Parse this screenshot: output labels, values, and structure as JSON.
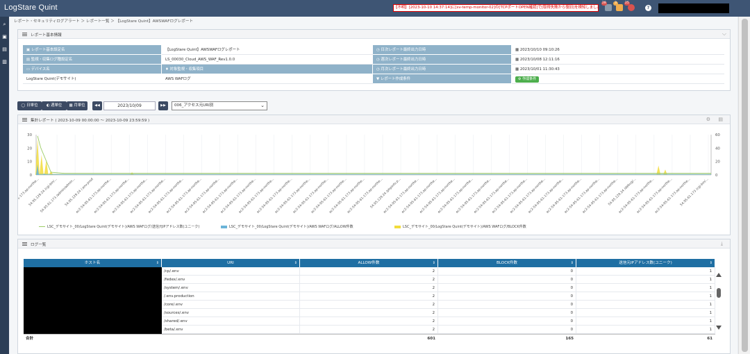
{
  "header": {
    "logo": "LogStare Quint",
    "alert": "【不明】[2023-10-10 14:37:14]に[sv-temp-monitor-02]の[TCPポートOPEN確認]で[取得失敗から復旧]を検知しました",
    "badges": [
      "28",
      "3",
      "25"
    ],
    "help": "?"
  },
  "breadcrumb": "レポート・セキュリティログアラート ＞ レポート一覧 ＞ 【LogStare Quint】AWSWAFログレポート",
  "report_info": {
    "panel_title": "レポート基本情報",
    "rows": [
      {
        "h1": "レポート基本設定名",
        "v1": "【LogStare Quint】AWSWAFログレポート",
        "h2": "日次レポート最終出力日時",
        "v2": "2023/10/10  09:10:26"
      },
      {
        "h1": "監視・収集ログ種設定名",
        "v1": "LS_00030_Cloud_AWS_WAF_Rev1.0.0",
        "h2": "週次レポート最終出力日時",
        "v2": "2023/10/08  12:11:16"
      },
      {
        "h1": "デバイス名",
        "v1": "対象監視・収集項目",
        "h2": "月次レポート最終出力日時",
        "v2": "2023/10/01  11:30:43"
      },
      {
        "h1": "LogStare Quint(デモサイト)",
        "v1": "AWS WAFログ",
        "h2": "レポート作成条件",
        "v2": "作成条件"
      }
    ]
  },
  "controls": {
    "daily": "日単位",
    "weekly": "週単位",
    "monthly": "月単位",
    "prev": "◀◀",
    "date": "2023/10/09",
    "next": "▶▶",
    "report_select": "006_アクセス元URI別"
  },
  "chart_panel": {
    "title": "集計レポート ( 2023-10-09 00:00:00 ～ 2023-10-09 23:59:59 )"
  },
  "chart_data": {
    "type": "area",
    "left_axis": {
      "ticks": [
        "30",
        "20",
        "10",
        "0"
      ],
      "ylim": [
        0,
        30
      ]
    },
    "right_axis": {
      "ticks": [
        "60",
        "40",
        "20",
        "0"
      ],
      "ylim": [
        0,
        60
      ]
    },
    "x_tick_labels": [
      "ec2-54-95-61-173.ap-northe...",
      "54.95.129.24 /cgi-bin/...",
      "54.95.61.173 /admin/admin...",
      "54.95.129.24 /.env.prod",
      "ec2-54-95-61-173.ap-northe...",
      "ec2-54-95-61-173.ap-northe...",
      "ec2-54-95-61-173.ap-northe...",
      "ec2-54-95-61-173.ap-northe...",
      "ec2-54-95-61-173.ap-northe...",
      "ec2-54-95-61-173.ap-northe...",
      "ec2-54-95-61-173.ap-northe...",
      "ec2-54-95-61-173.ap-northe...",
      "ec2-54-95-61-173.ap-northe...",
      "ec2-54-95-61-173.ap-northe...",
      "ec2-54-95-61-173.ap-northe...",
      "ec2-54-95-61-173.ap-northe...",
      "ec2-54-95-61-173.ap-northe...",
      "ec2-54-95-61-173.ap-northe...",
      "ec2-54-95-61-173.ap-northe...",
      "ec2-54-95-61-173.ap-northe...",
      "54.95.129.24 /phpinfo.p...",
      "ec2-54-95-61-173.ap-northe...",
      "ec2-54-95-61-173.ap-northe...",
      "ec2-54-95-61-173.ap-northe...",
      "ec2-54-95-61-173.ap-northe...",
      "ec2-54-95-61-173.ap-northe...",
      "ec2-54-95-61-173.ap-northe...",
      "ec2-54-95-61-173.ap-northe...",
      "ec2-54-95-61-173.ap-northe...",
      "ec2-54-95-61-173.ap-northe...",
      "ec2-54-95-61-173.ap-northe...",
      "ec2-54-95-61-173.ap-northe...",
      "ec2-54-95-61-173.ap-northe...",
      "54.95.129.24 /debug/...",
      "ec2-54-95-61-173.ap-northe...",
      "ec2-54-95-61-173.ap-northe...",
      "ec2-54-95-61-173.ap-northe...",
      "54.95.61.173 /cgi-bin/..."
    ],
    "series": [
      {
        "name": "LSC_デモサイト_00/LogStare Quint(デモサイト)/AWS WAFログ/送信元IPアドレス数(ユニーク)",
        "color": "#9ccc65",
        "axis": "left"
      },
      {
        "name": "LSC_デモサイト_00/LogStare Quint(デモサイト)/AWS WAFログ/ALLOW件数",
        "color": "#6ab4d8",
        "axis": "right"
      },
      {
        "name": "LSC_デモサイト_00/LogStare Quint(デモサイト)/AWS WAFログ/BLOCK件数",
        "color": "#f2dc3b",
        "axis": "right"
      }
    ],
    "spikes": {
      "uniq": [
        {
          "x": 0.0,
          "y": 29
        },
        {
          "x": 0.005,
          "y": 20
        },
        {
          "x": 0.02,
          "y": 2
        }
      ],
      "allow": [
        {
          "x": 0.0,
          "y": 16
        },
        {
          "x": 0.01,
          "y": 2
        }
      ],
      "block": [
        {
          "x": 0.0,
          "y": 54
        },
        {
          "x": 0.006,
          "y": 30
        },
        {
          "x": 0.013,
          "y": 22
        },
        {
          "x": 0.02,
          "y": 6
        },
        {
          "x": 0.14,
          "y": 4
        },
        {
          "x": 0.92,
          "y": 14
        },
        {
          "x": 0.93,
          "y": 8
        }
      ]
    }
  },
  "log_panel": {
    "title": "ログ一覧",
    "columns": [
      "ホスト名",
      "URI",
      "ALLOW件数",
      "BLOCK件数",
      "送信元IPアドレス数(ユニーク)"
    ],
    "rows": [
      {
        "uri": "/cp/.env",
        "allow": "2",
        "block": "0",
        "uniq": "1"
      },
      {
        "uri": "/fedex/.env",
        "allow": "2",
        "block": "0",
        "uniq": "1"
      },
      {
        "uri": "/system/.env",
        "allow": "2",
        "block": "0",
        "uniq": "1"
      },
      {
        "uri": "/.env.production",
        "allow": "2",
        "block": "0",
        "uniq": "1"
      },
      {
        "uri": "/core/.env",
        "allow": "2",
        "block": "0",
        "uniq": "1"
      },
      {
        "uri": "/sources/.env",
        "allow": "2",
        "block": "0",
        "uniq": "1"
      },
      {
        "uri": "/shared/.env",
        "allow": "2",
        "block": "0",
        "uniq": "1"
      },
      {
        "uri": "/beta/.env",
        "allow": "2",
        "block": "0",
        "uniq": "1"
      }
    ],
    "footer": {
      "label": "合計",
      "allow": "601",
      "block": "165",
      "uniq": "61"
    }
  }
}
